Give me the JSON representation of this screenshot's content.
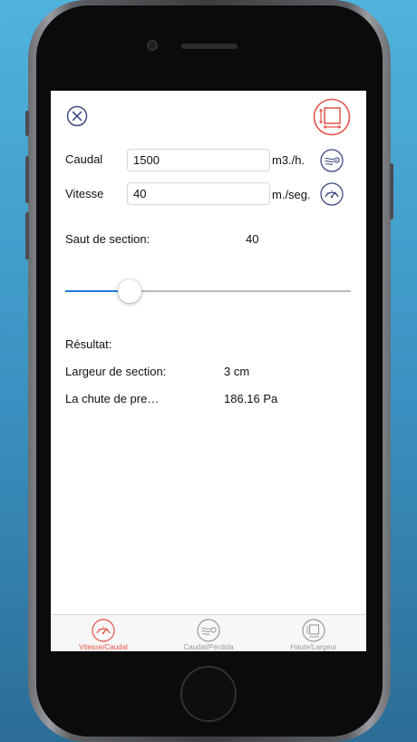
{
  "colors": {
    "accent": "#e5534b",
    "navy": "#3f4a80",
    "tab_inactive": "#9a9a9a",
    "slider_fill": "#1b7bd8"
  },
  "toolbar": {
    "close_icon": "close-circle-icon",
    "section_icon": "resize-section-icon"
  },
  "form": {
    "caudal_label": "Caudal",
    "caudal_value": "1500",
    "caudal_unit": "m3./h.",
    "caudal_icon": "airflow-icon",
    "vitesse_label": "Vitesse",
    "vitesse_value": "40",
    "vitesse_unit": "m./seg.",
    "vitesse_icon": "gauge-icon"
  },
  "slider": {
    "label": "Saut de section:",
    "value_text": "40",
    "fraction": 0.225
  },
  "results": {
    "heading": "Résultat:",
    "largeur_label": "Largeur de section:",
    "largeur_value": "3 cm",
    "chute_label": "La chute de pre…",
    "chute_value": "186.16 Pa"
  },
  "tabs": [
    {
      "label": "Vitesse/Caudal",
      "icon": "gauge-icon",
      "active": true
    },
    {
      "label": "Caudal/Pérdida",
      "icon": "airflow-icon",
      "active": false
    },
    {
      "label": "Haute/Largeur",
      "icon": "resize-section-icon",
      "active": false
    }
  ]
}
